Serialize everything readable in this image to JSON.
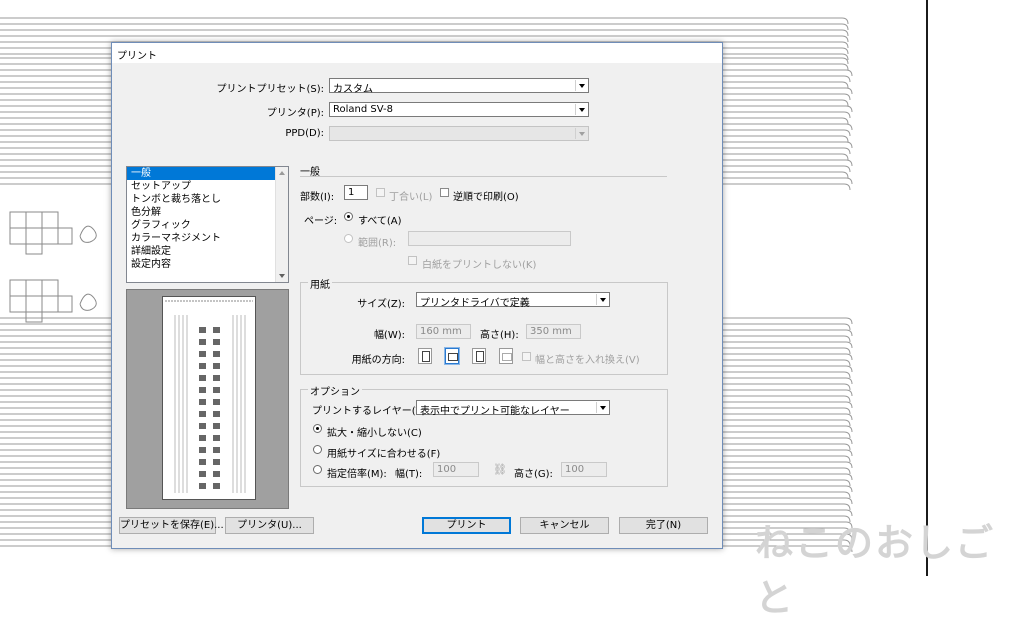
{
  "dialog": {
    "title": "プリント",
    "preset_label": "プリントプリセット(S):",
    "preset_value": "カスタム",
    "printer_label": "プリンタ(P):",
    "printer_value": "Roland SV-8",
    "ppd_label": "PPD(D):",
    "ppd_value": ""
  },
  "sidebar": {
    "items": [
      {
        "label": "一般",
        "selected": true
      },
      {
        "label": "セットアップ"
      },
      {
        "label": "トンボと裁ち落とし"
      },
      {
        "label": "色分解"
      },
      {
        "label": "グラフィック"
      },
      {
        "label": "カラーマネジメント"
      },
      {
        "label": "詳細設定"
      },
      {
        "label": "設定内容"
      }
    ]
  },
  "general": {
    "section_title": "一般",
    "copies_label": "部数(I):",
    "copies_value": "1",
    "collate_label": "丁合い(L)",
    "reverse_label": "逆順で印刷(O)",
    "pages_label": "ページ:",
    "all_label": "すべて(A)",
    "range_label": "範囲(R):",
    "range_value": "",
    "print_blank_label": "白紙をプリントしない(K)"
  },
  "paper": {
    "group_title": "用紙",
    "size_label": "サイズ(Z):",
    "size_value": "プリンタドライバで定義",
    "width_label": "幅(W):",
    "width_value": "160 mm",
    "height_label": "高さ(H):",
    "height_value": "350 mm",
    "orientation_label": "用紙の方向:",
    "swap_label": "幅と高さを入れ換え(V)"
  },
  "options": {
    "group_title": "オプション",
    "layers_label": "プリントするレイヤー(Y):",
    "layers_value": "表示中でプリント可能なレイヤー",
    "no_scale_label": "拡大・縮小しない(C)",
    "fit_label": "用紙サイズに合わせる(F)",
    "scale_label": "指定倍率(M):",
    "scale_w_label": "幅(T):",
    "scale_w_value": "100",
    "scale_h_label": "高さ(G):",
    "scale_h_value": "100"
  },
  "buttons": {
    "save_preset": "プリセットを保存(E)...",
    "printer": "プリンタ(U)...",
    "print": "プリント",
    "cancel": "キャンセル",
    "done": "完了(N)"
  },
  "watermark": "ねこのおしごと"
}
